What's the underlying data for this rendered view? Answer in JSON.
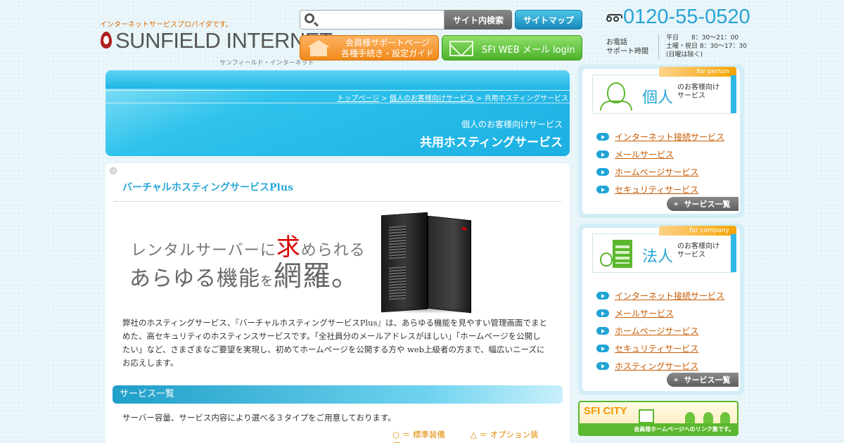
{
  "header": {
    "tagline": "インターネットサービスプロバイダです。",
    "logo_text": "SUNFIELD INTERNET",
    "logo_sub": "サンフィールド・インターネット",
    "search_placeholder": "",
    "site_search_label": "サイト内検索",
    "sitemap_label": "サイトマップ",
    "member_line1": "会員様サポートページ",
    "member_line2": "各種手続き・設定ガイド",
    "mail_label": "SFI WEB メール  login",
    "tel": "0120-55-0520",
    "tel_label_1": "お電話",
    "tel_label_2": "サポート時間",
    "hours_1": "平日　　8：30〜21：00",
    "hours_2": "土曜・祝日 8：30〜17：30",
    "hours_3": "(日曜は除く)"
  },
  "breadcrumb": {
    "items": [
      "トップページ",
      "個人のお客様向けサービス"
    ],
    "sep": " > ",
    "current": "共用ホスティングサービス"
  },
  "hero": {
    "subtitle": "個人のお客様向けサービス",
    "title": "共用ホスティングサービス"
  },
  "content": {
    "product_title": "バーチャルホスティングサービスPlus",
    "promo_line1_a": "レンタルサーバーに",
    "promo_line1_red": "求",
    "promo_line1_b": "められる",
    "promo_line2_a": "あらゆる機能",
    "promo_line2_small": "を",
    "promo_line2_big": "網羅。",
    "description": "弊社のホスティングサービス、『バーチャルホスティングサービスPlus』は、あらゆる機能を見やすい管理画面でまとめた、高セキュリティのホスティンスサービスです。「全社員分のメールアドレスがほしい」「ホームページを公開したい」など、さまざまなご要望を実現し、初めてホームページを公開する方や web上級者の方まで、幅広いニーズにお応えします。",
    "section_title": "サービス一覧",
    "section_text": "サーバー容量、サービス内容により選べる３タイプをご用意しております。",
    "legend_standard": "○ ＝ 標準装備",
    "legend_option": "△ ＝ オプション装備"
  },
  "sidebar": {
    "person": {
      "corner": "for person",
      "category": "個人",
      "category_sub": "のお客様向け\nサービス",
      "items": [
        "インターネット接続サービス",
        "メールサービス",
        "ホームページサービス",
        "セキュリティサービス"
      ],
      "more": "サービス一覧"
    },
    "company": {
      "corner": "for company",
      "category": "法人",
      "category_sub": "のお客様向け\nサービス",
      "items": [
        "インターネット接続サービス",
        "メールサービス",
        "ホームページサービス",
        "セキュリティサービス",
        "ホスティングサービス"
      ],
      "more": "サービス一覧"
    },
    "banner": {
      "name": "SFI CITY",
      "sub": "会員様ホームページへのリンク集です。"
    }
  },
  "colors": {
    "accent_blue": "#2aa8d8",
    "accent_orange": "#f08a1c",
    "accent_green": "#5cb82e",
    "link": "#c85a00"
  }
}
